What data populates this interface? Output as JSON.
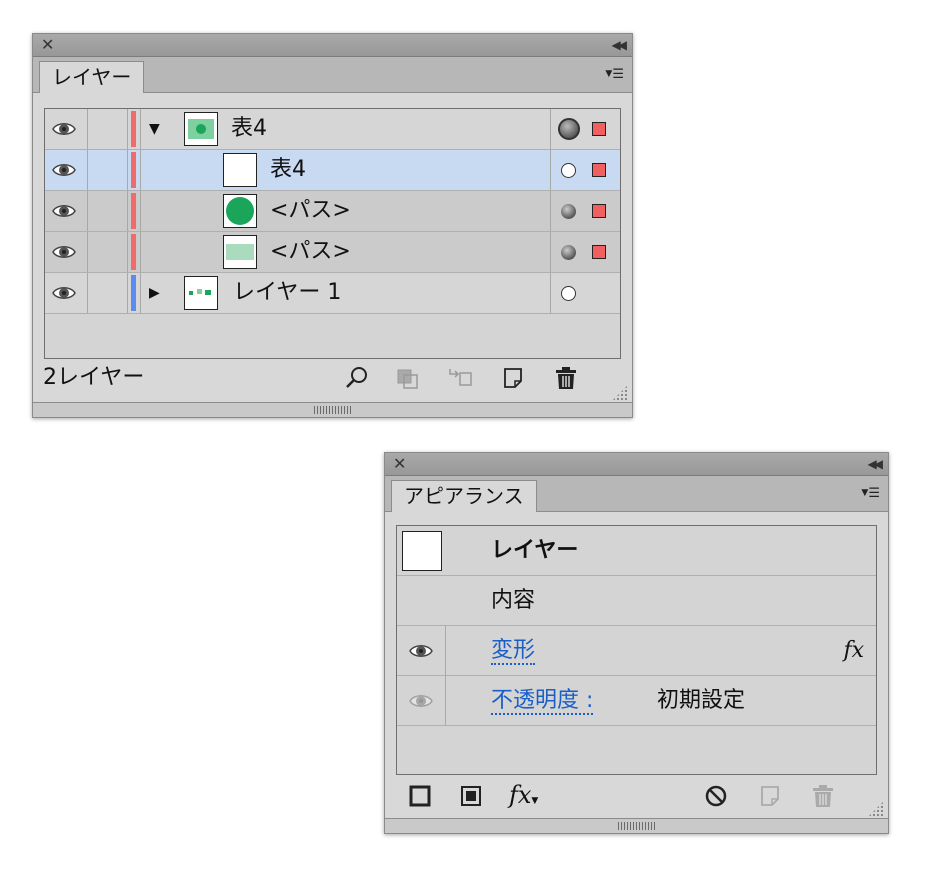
{
  "layers_panel": {
    "tab_label": "レイヤー",
    "rows": [
      {
        "label": "表4",
        "expander": "▼",
        "selected": false
      },
      {
        "label": "表4",
        "expander": "",
        "selected": true
      },
      {
        "label": "<パス>",
        "expander": "",
        "selected": false
      },
      {
        "label": "<パス>",
        "expander": "",
        "selected": false
      },
      {
        "label": "レイヤー 1",
        "expander": "▶",
        "selected": false
      }
    ],
    "layer_count": "2レイヤー",
    "colors": {
      "layer_red": "#f06c6c",
      "layer_blue": "#5b8bf0",
      "selected_row": "#c8d9f2",
      "thumb_green": "#1aa55a"
    },
    "footer_icons": [
      "search-icon",
      "make-clipping-mask-icon",
      "create-sublayer-icon",
      "new-layer-icon",
      "trash-icon"
    ]
  },
  "appearance_panel": {
    "tab_label": "アピアランス",
    "header_label": "レイヤー",
    "contents_label": "内容",
    "transform_label": "変形",
    "fx_label": "fx",
    "opacity_label": "不透明度 :",
    "opacity_value": "初期設定",
    "footer_fx_label": "fx",
    "footer_icons": [
      "add-stroke-icon",
      "add-fill-icon",
      "fx-menu-icon",
      "clear-appearance-icon",
      "duplicate-item-icon",
      "trash-icon"
    ]
  }
}
